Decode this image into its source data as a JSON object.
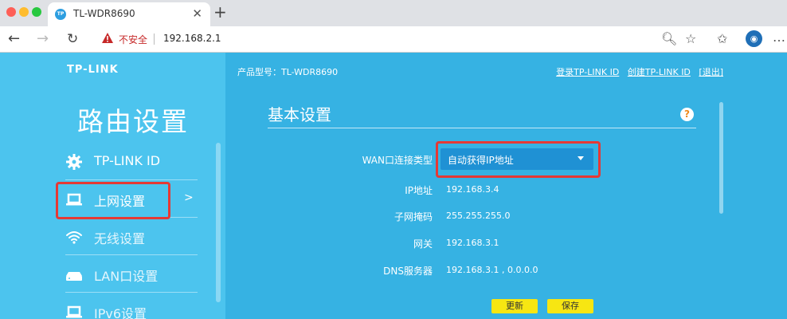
{
  "browser": {
    "tab_title": "TL-WDR8690",
    "tab_favicon": "TP",
    "tab_close": "✕",
    "new_tab": "+",
    "insecure_label": "不安全",
    "url": "192.168.2.1",
    "icons": [
      "back-icon",
      "forward-icon",
      "reload-icon",
      "warning-icon",
      "zoom-icon",
      "star-icon",
      "favorites-icon",
      "profile-icon",
      "more-icon"
    ]
  },
  "router": {
    "logo": "TP-LINK",
    "sidebar_title": "路由设置",
    "sidebar_items": [
      {
        "label": "TP-LINK ID",
        "icon": "gear-icon"
      },
      {
        "label": "上网设置",
        "icon": "laptop-icon",
        "arrow": ">"
      },
      {
        "label": "无线设置",
        "icon": "wifi-icon"
      },
      {
        "label": "LAN口设置",
        "icon": "router-icon"
      },
      {
        "label": "IPv6设置",
        "icon": "laptop-icon"
      }
    ],
    "model_label": "产品型号：TL-WDR8690",
    "top_links": [
      "登录TP-LINK ID",
      "创建TP-LINK ID",
      "[退出]"
    ],
    "section_title": "基本设置",
    "help": "?",
    "form": {
      "wan_type_label": "WAN口连接类型",
      "wan_type_value": "自动获得IP地址",
      "ip_label": "IP地址",
      "ip_value": "192.168.3.4",
      "mask_label": "子网掩码",
      "mask_value": "255.255.255.0",
      "gateway_label": "网关",
      "gateway_value": "192.168.3.1",
      "dns_label": "DNS服务器",
      "dns_value": "192.168.3.1 , 0.0.0.0"
    },
    "buttons": {
      "refresh": "更新",
      "save": "保存"
    },
    "colors": {
      "sidebar": "#4cc4ee",
      "main": "#36b2e3",
      "highlight": "#e53935",
      "button": "#f7e612"
    }
  }
}
